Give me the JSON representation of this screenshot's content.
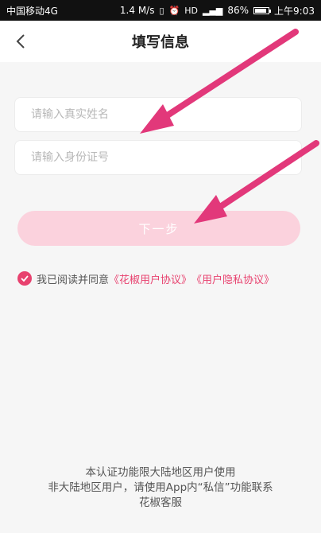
{
  "status_bar": {
    "carrier": "中国移动4G",
    "speed": "1.4 M/s",
    "battery_percent": "86%",
    "time": "上午9:03",
    "battery_level": 0.86
  },
  "navbar": {
    "title": "填写信息",
    "back_icon": "chevron-left-icon"
  },
  "form": {
    "name_placeholder": "请输入真实姓名",
    "name_value": "",
    "id_placeholder": "请输入身份证号",
    "id_value": "",
    "next_label": "下一步"
  },
  "agreement": {
    "checked": true,
    "prefix": "我已阅读并同意",
    "link1": "《花椒用户协议》",
    "link2": "《用户隐私协议》"
  },
  "footer": {
    "line1": "本认证功能限大陆地区用户使用",
    "line2": "非大陆地区用户，请使用App内“私信”功能联系",
    "line3": "花椒客服"
  },
  "colors": {
    "accent": "#e8426f",
    "button_disabled": "#fbd2dd",
    "annotation_arrow": "#e2387a"
  }
}
